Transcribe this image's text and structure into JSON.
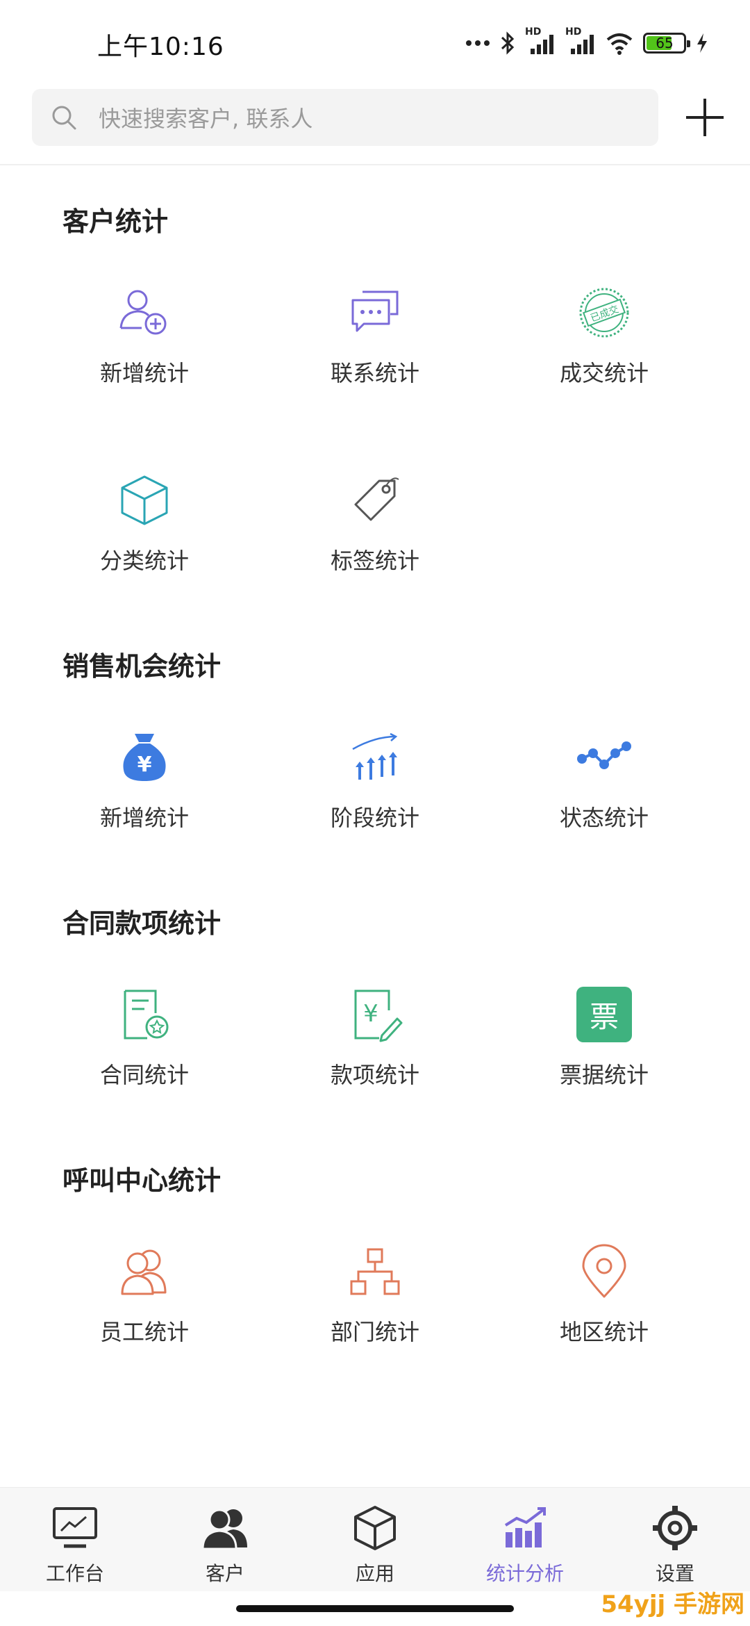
{
  "status_bar": {
    "time": "上午10:16",
    "battery": "65",
    "hd_label_1": "HD",
    "hd_label_2": "HD"
  },
  "search": {
    "placeholder": "快速搜索客户, 联系人"
  },
  "sections": [
    {
      "title": "客户统计",
      "items": [
        {
          "label": "新增统计",
          "icon": "user-add-icon",
          "color": "#7a6ad8"
        },
        {
          "label": "联系统计",
          "icon": "chat-bubbles-icon",
          "color": "#7a6ad8"
        },
        {
          "label": "成交统计",
          "icon": "deal-stamp-icon",
          "color": "#3fb27f"
        },
        {
          "label": "分类统计",
          "icon": "cube-icon",
          "color": "#2aa5b4"
        },
        {
          "label": "标签统计",
          "icon": "tag-icon",
          "color": "#555555"
        }
      ]
    },
    {
      "title": "销售机会统计",
      "items": [
        {
          "label": "新增统计",
          "icon": "money-bag-icon",
          "color": "#3d7be0"
        },
        {
          "label": "阶段统计",
          "icon": "stage-arrows-icon",
          "color": "#3d7be0"
        },
        {
          "label": "状态统计",
          "icon": "status-dots-icon",
          "color": "#3d7be0"
        }
      ]
    },
    {
      "title": "合同款项统计",
      "items": [
        {
          "label": "合同统计",
          "icon": "contract-doc-icon",
          "color": "#3fb27f"
        },
        {
          "label": "款项统计",
          "icon": "payment-doc-icon",
          "color": "#3fb27f"
        },
        {
          "label": "票据统计",
          "icon": "ticket-icon",
          "color": "#3fb27f",
          "icon_text": "票"
        }
      ]
    },
    {
      "title": "呼叫中心统计",
      "items": [
        {
          "label": "员工统计",
          "icon": "staff-icon",
          "color": "#e07a5a"
        },
        {
          "label": "部门统计",
          "icon": "org-chart-icon",
          "color": "#e07a5a"
        },
        {
          "label": "地区统计",
          "icon": "location-pin-icon",
          "color": "#e07a5a"
        }
      ]
    }
  ],
  "bottom_nav": [
    {
      "label": "工作台",
      "icon": "monitor-chart-icon",
      "active": false
    },
    {
      "label": "客户",
      "icon": "customers-icon",
      "active": false
    },
    {
      "label": "应用",
      "icon": "box-icon",
      "active": false
    },
    {
      "label": "统计分析",
      "icon": "bar-chart-icon",
      "active": true
    },
    {
      "label": "设置",
      "icon": "gear-icon",
      "active": false
    }
  ],
  "colors": {
    "accent": "#7a6ad8",
    "green": "#3fb27f",
    "blue": "#3d7be0",
    "orange": "#e07a5a"
  },
  "watermark": "54yjj 手游网"
}
